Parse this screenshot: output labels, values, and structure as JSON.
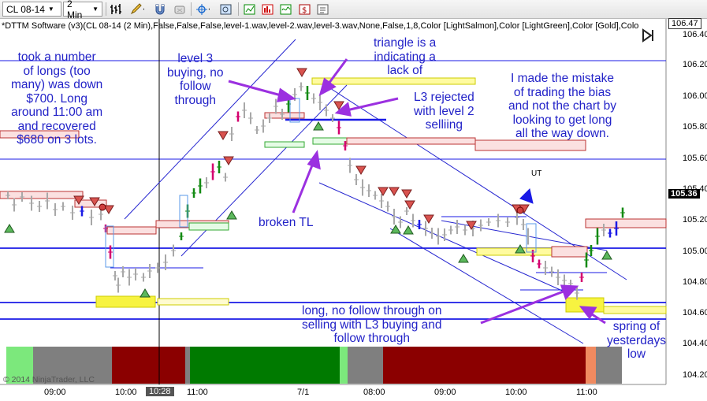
{
  "toolbar": {
    "instrument": "CL 08-14",
    "interval": "2 Min",
    "icons": [
      "bar-type-icon",
      "pencil-draw-icon",
      "magnet-icon",
      "crosshair-icon",
      "zoom-icon",
      "data-box-icon",
      "bar-chart-icon",
      "indicator-icon",
      "strategy-icon",
      "properties-icon"
    ]
  },
  "indicator_line": "*DTTM Software (v3)(CL 08-14 (2 Min),False,False,False,level-1.wav,level-2.wav,level-3.wav,None,False,1,8,Color [LightSalmon],Color [LightGreen],Color [Gold],Colo",
  "annotations": {
    "longs": "took a  number\nof longs (too\nmany) was down\n$700.  Long\naround 11:00 am\nand recovered\n$680 on 3 lots.",
    "level3": "level 3\nbuying, no\nfollow\nthrough",
    "triangle": "triangle is a\nindicating a\nlack of",
    "l3rejected": "L3 rejected\nwith level 2\nselliing",
    "mistake": "I made the mistake\nof trading the bias\nand not the chart by\nlooking to get long\nall the way down.",
    "broken_tl": "broken TL",
    "long_no_follow": "long, no follow through on\nselling with L3 buying and\nfollow through",
    "spring": "spring of\nyesterdays\nlow",
    "ut": "UT"
  },
  "copyright": "© 2014 NinjaTrader, LLC",
  "x_axis": {
    "labels": [
      "09:00",
      "10:00",
      "10:28",
      "11:00",
      "7/1",
      "08:00",
      "09:00",
      "10:00",
      "11:00"
    ],
    "highlight": "10:28"
  },
  "y_axis": {
    "labels": [
      "106.40",
      "106.20",
      "106.00",
      "105.80",
      "105.60",
      "105.40",
      "105.20",
      "105.00",
      "104.80",
      "104.60",
      "104.40",
      "104.20"
    ],
    "top_tag": "106.47",
    "last_price": "105.36"
  },
  "colors": {
    "price_bar": "#a8a8a8",
    "up_bar": "#128a12",
    "down_bar": "#d4006e",
    "blue_bar": "#1a1ae6",
    "trendline": "#2525d0",
    "level": "#1a1ae6",
    "annotation": "#2323c8",
    "arrow": "#9b30e0",
    "sell_marker": "#d9534f",
    "buy_marker": "#5cb85c",
    "bias_red": "#8b0000",
    "bias_green": "#007a00",
    "bias_gray": "#7f7f7f",
    "bias_lightgreen": "#7ce87c",
    "bias_salmon": "#f08a60"
  }
}
